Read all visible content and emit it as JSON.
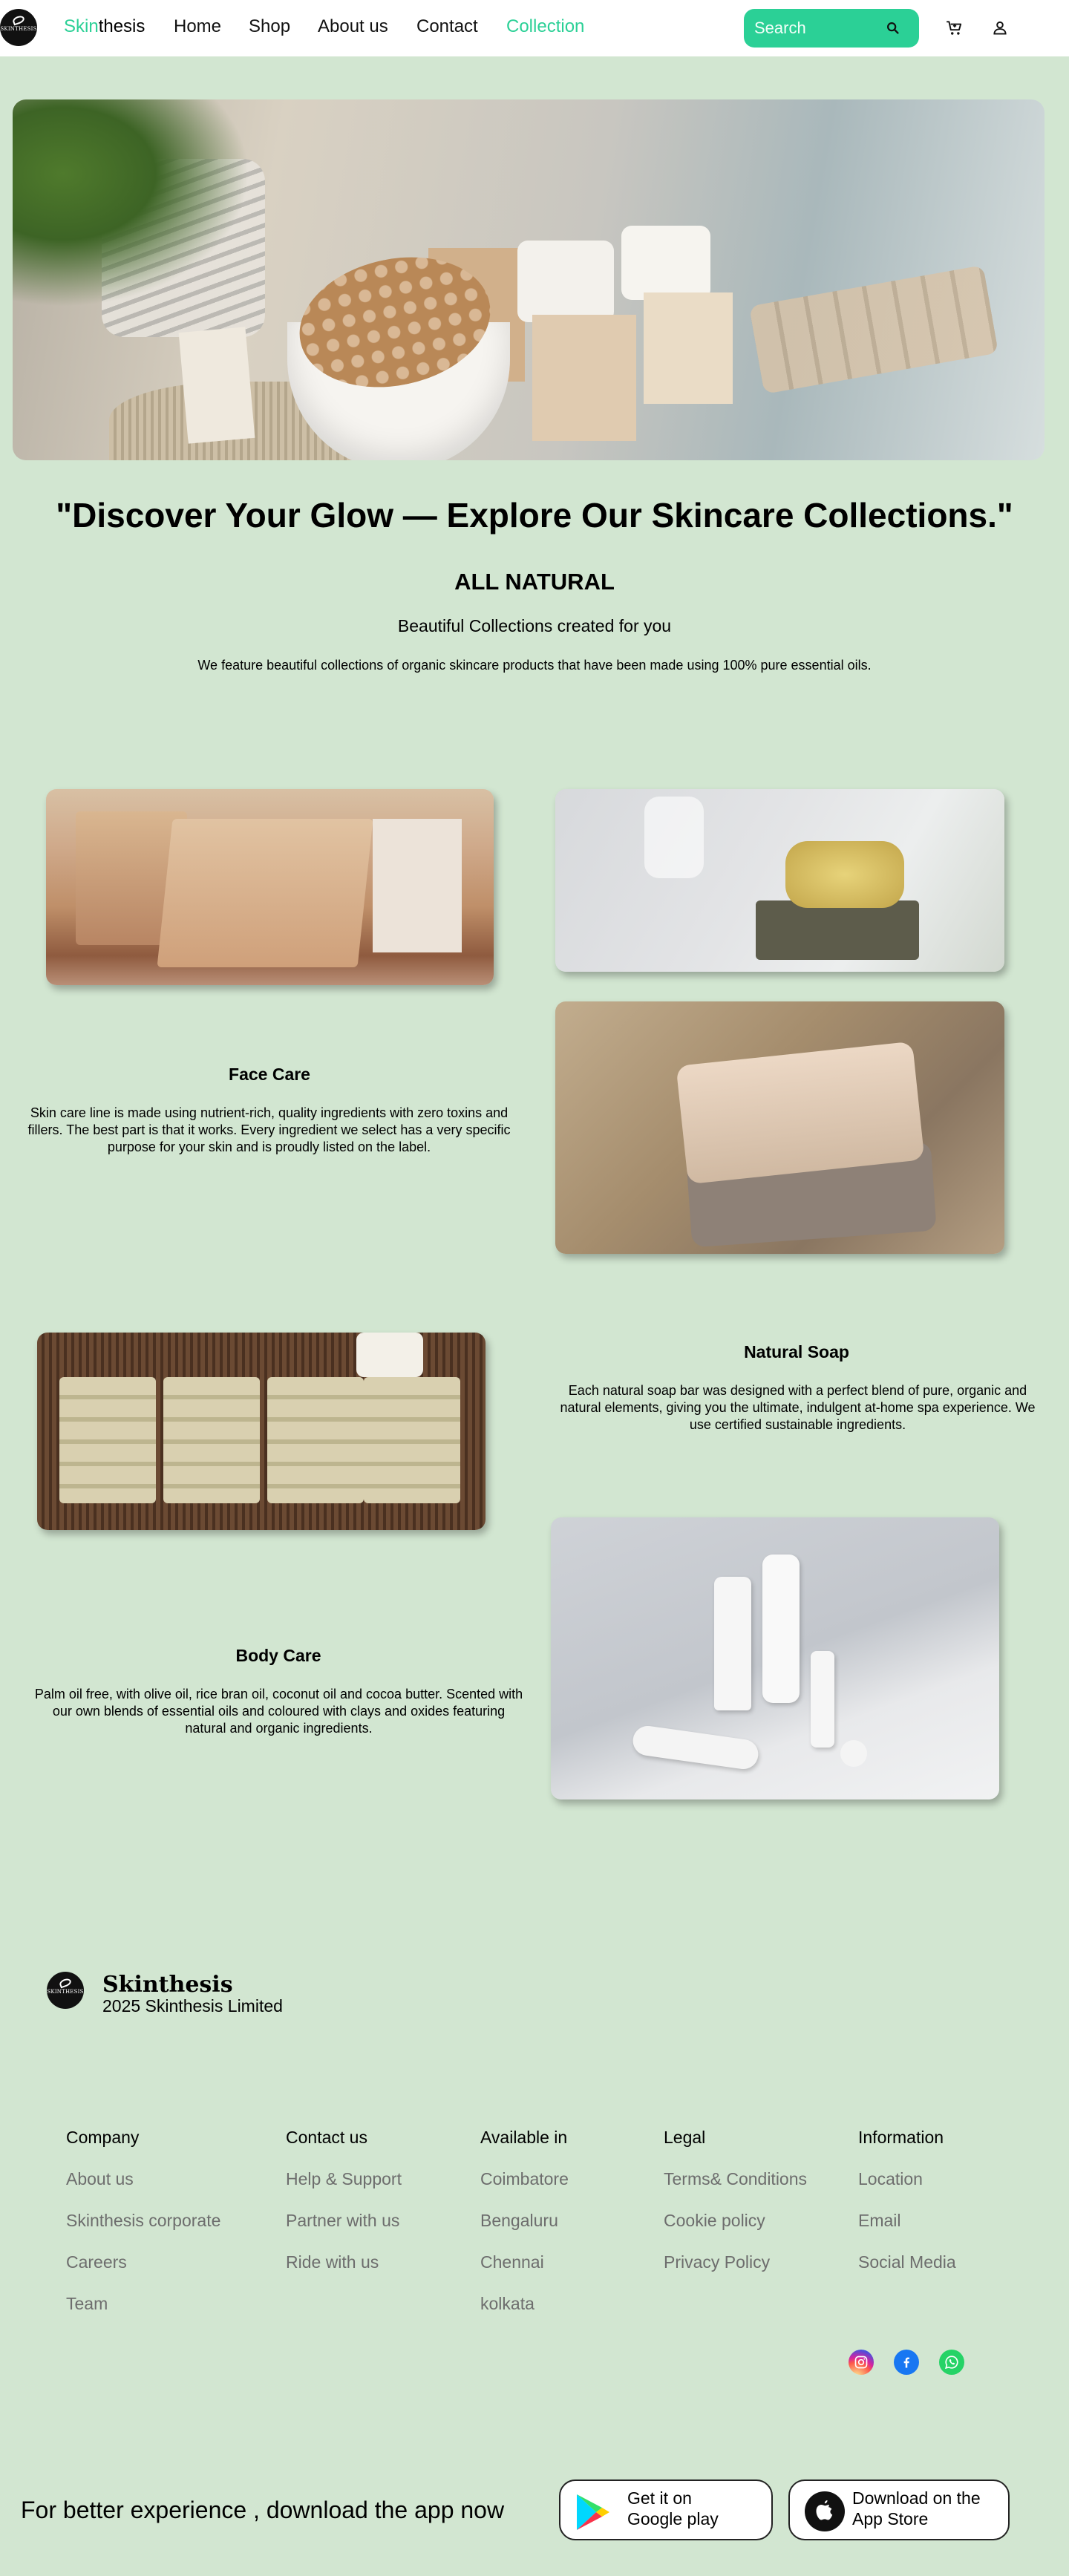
{
  "nav": {
    "brand_accent": "Skin",
    "brand_rest": "thesis",
    "logo_text": "SKINTHESIS",
    "links": [
      "Home",
      "Shop",
      "About us",
      "Contact",
      "Collection"
    ],
    "active_link": "Collection",
    "search_placeholder": "Search",
    "accent_color": "#2bd096"
  },
  "hero": {
    "tagline": "\"Discover Your Glow — Explore Our Skincare Collections.\"",
    "heading": "ALL NATURAL",
    "subheading": "Beautiful Collections created for you",
    "description": "We feature beautiful collections of organic skincare products that have been made using 100% pure essential oils."
  },
  "products": [
    {
      "title": "Face Care",
      "description": "Skin care line is made using nutrient-rich, quality ingredients with zero toxins and fillers. The best part is that it works. Every ingredient we select has a very specific purpose for your skin and is proudly listed on the label."
    },
    {
      "title": "Natural Soap",
      "description": "Each natural soap bar was designed with a perfect blend of pure, organic and natural elements, giving you the ultimate, indulgent at-home spa experience. We use certified sustainable ingredients."
    },
    {
      "title": "Body Care",
      "description": "Palm oil free, with olive oil, rice bran oil, coconut oil and cocoa butter. Scented with our own blends of essential oils and coloured with clays and oxides featuring natural and organic ingredients."
    }
  ],
  "footer": {
    "brand": "Skinthesis",
    "copyright": "2025 Skinthesis Limited",
    "columns": [
      {
        "heading": "Company",
        "links": [
          "About us",
          "Skinthesis corporate",
          "Careers",
          "Team"
        ]
      },
      {
        "heading": "Contact us",
        "links": [
          "Help & Support",
          "Partner with us",
          "Ride with us"
        ]
      },
      {
        "heading": "Available in",
        "links": [
          "Coimbatore",
          "Bengaluru",
          "Chennai",
          "kolkata"
        ]
      },
      {
        "heading": "Legal",
        "links": [
          "Terms& Conditions",
          "Cookie policy",
          "Privacy Policy"
        ]
      },
      {
        "heading": "Information",
        "links": [
          "Location",
          "Email",
          "Social Media"
        ]
      }
    ],
    "social_icons": [
      "instagram-icon",
      "facebook-icon",
      "whatsapp-icon"
    ],
    "download_text": "For better experience , download the app now",
    "google_play": {
      "line1": "Get it on",
      "line2": "Google play"
    },
    "app_store": {
      "line1": "Download on the",
      "line2": "App Store"
    }
  }
}
